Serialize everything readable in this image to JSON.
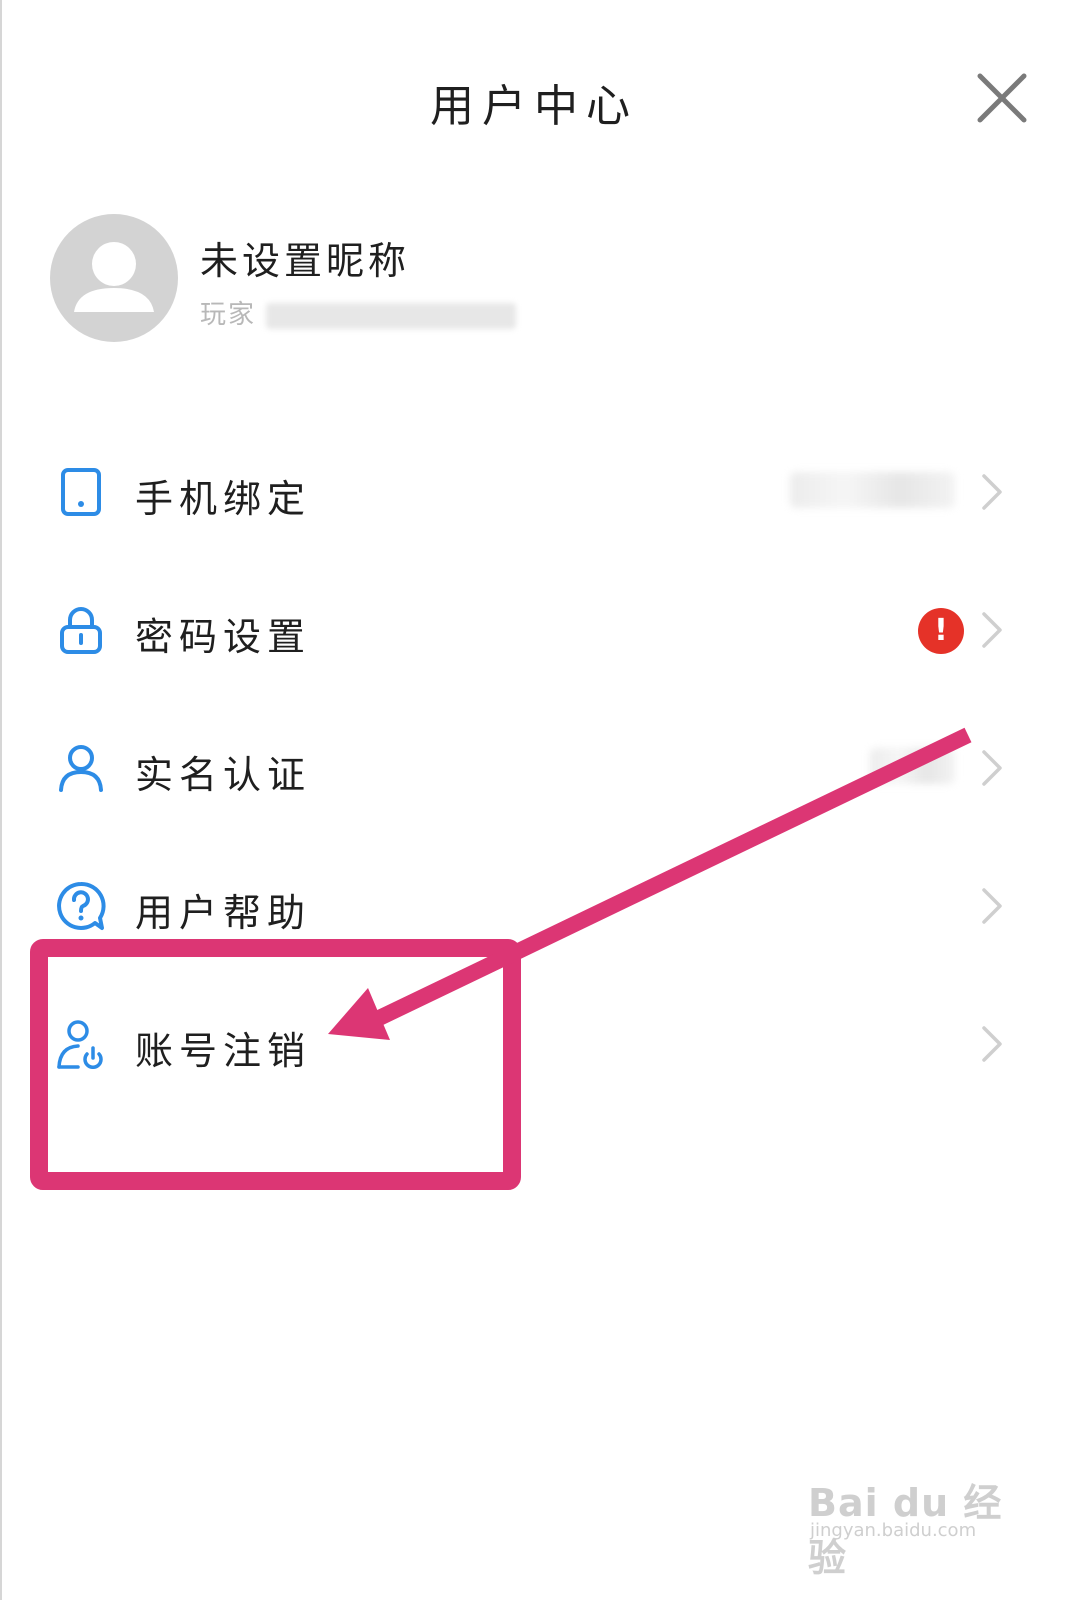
{
  "header": {
    "title": "用户中心",
    "close_icon": "close-icon"
  },
  "profile": {
    "avatar_icon": "default-avatar-icon",
    "nickname": "未设置昵称",
    "account_prefix": "玩家"
  },
  "menu": {
    "items": [
      {
        "label": "手机绑定",
        "icon": "phone-icon",
        "value_masked": true
      },
      {
        "label": "密码设置",
        "icon": "lock-icon",
        "badge": "!"
      },
      {
        "label": "实名认证",
        "icon": "person-icon",
        "value_masked": true
      },
      {
        "label": "用户帮助",
        "icon": "help-icon"
      },
      {
        "label": "账号注销",
        "icon": "account-logout-icon"
      }
    ],
    "chevron_icon": "chevron-right-icon"
  },
  "annotation": {
    "color": "#dc3674",
    "highlight_target": "账号注销"
  },
  "watermark": {
    "logo": "Bai du 经验",
    "url": "jingyan.baidu.com"
  },
  "colors": {
    "icon_blue": "#2d8ce6",
    "badge_red": "#e53228",
    "chevron_gray": "#cfcfcf",
    "avatar_gray": "#d3d3d3"
  }
}
